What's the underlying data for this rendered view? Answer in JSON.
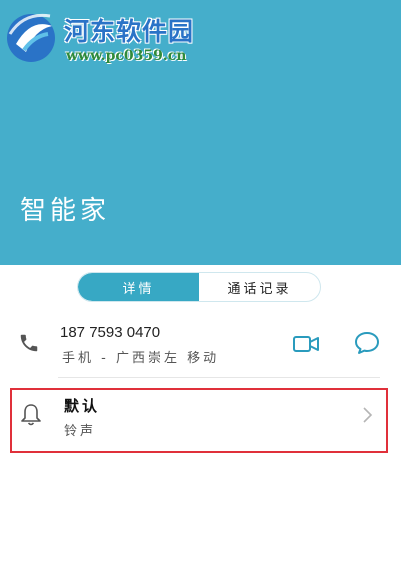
{
  "watermark": {
    "site_name": "河东软件园",
    "url": "www.pc0359.cn"
  },
  "contact": {
    "name": "智能家"
  },
  "tabs": [
    {
      "label": "详情",
      "active": true
    },
    {
      "label": "通话记录",
      "active": false
    }
  ],
  "phone": {
    "number": "187 7593 0470",
    "description": "手机 - 广西崇左 移动"
  },
  "ringtone": {
    "title": "默认",
    "subtitle": "铃声"
  },
  "colors": {
    "header": "#45aecb",
    "accent": "#37a8c4",
    "highlight_border": "#e0303a"
  },
  "icons": [
    "phone-icon",
    "video-call-icon",
    "message-icon",
    "bell-icon",
    "chevron-right-icon"
  ]
}
